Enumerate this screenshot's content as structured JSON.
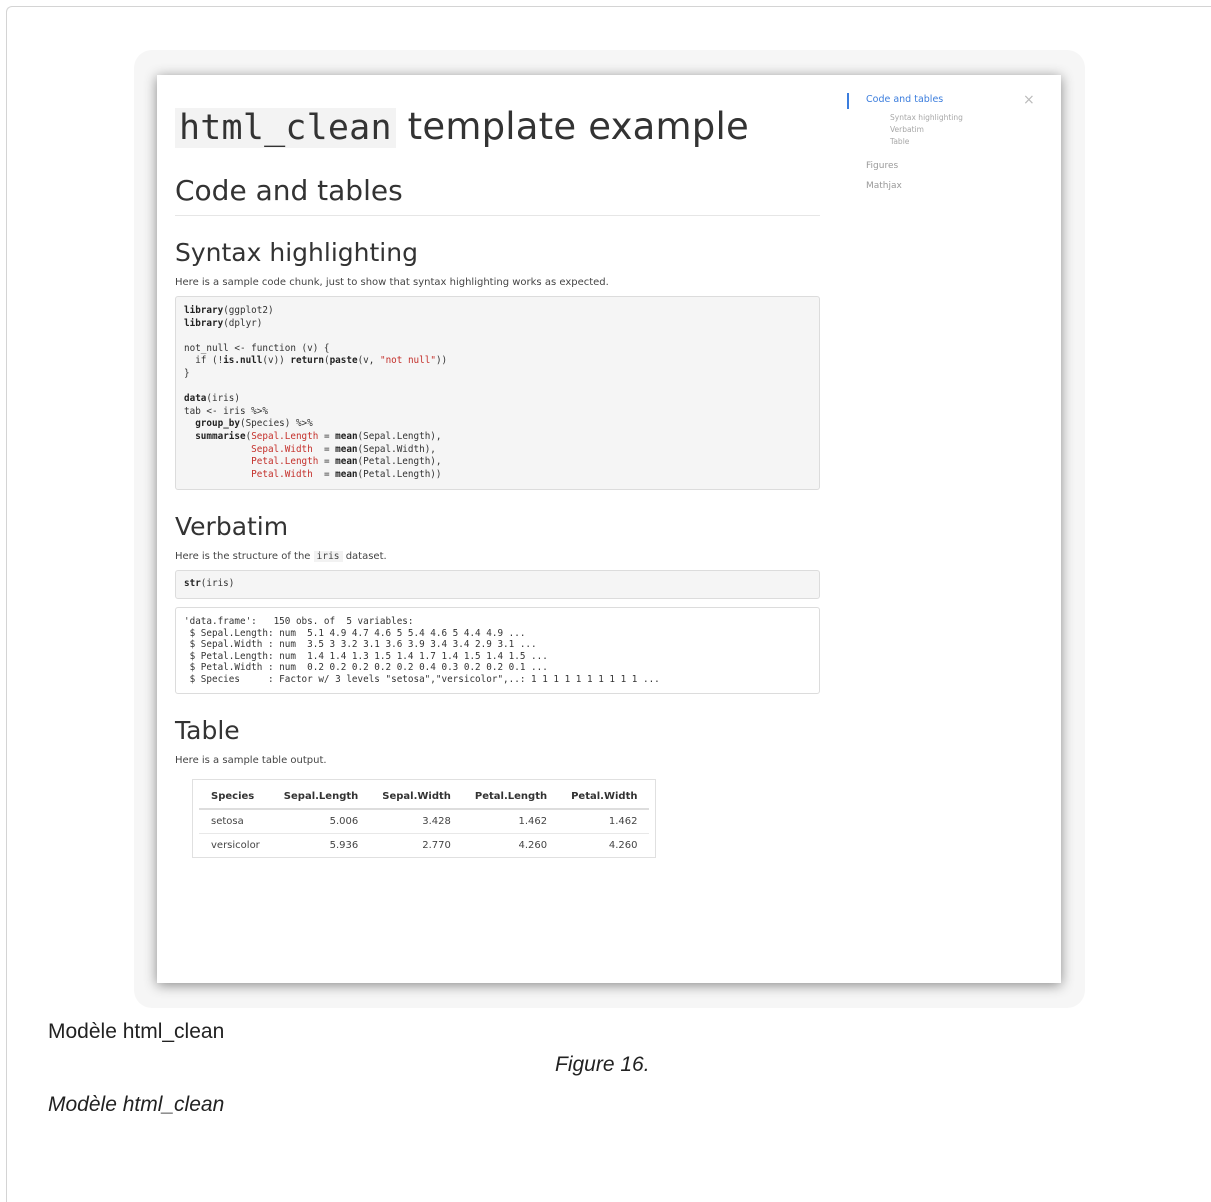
{
  "doc": {
    "title_code": "html_clean",
    "title_rest": " template example",
    "section_code_tables": "Code and tables",
    "sub_syntax": "Syntax highlighting",
    "syntax_para": "Here is a sample code chunk, just to show that syntax highlighting works as expected.",
    "sub_verbatim": "Verbatim",
    "verbatim_para_pre": "Here is the structure of the ",
    "verbatim_para_code": "iris",
    "verbatim_para_post": " dataset.",
    "str_call": "str(iris)",
    "str_output": "'data.frame':\t150 obs. of  5 variables:\n $ Sepal.Length: num  5.1 4.9 4.7 4.6 5 5.4 4.6 5 4.4 4.9 ...\n $ Sepal.Width : num  3.5 3 3.2 3.1 3.6 3.9 3.4 3.4 2.9 3.1 ...\n $ Petal.Length: num  1.4 1.4 1.3 1.5 1.4 1.7 1.4 1.5 1.4 1.5 ...\n $ Petal.Width : num  0.2 0.2 0.2 0.2 0.2 0.4 0.3 0.2 0.2 0.1 ...\n $ Species     : Factor w/ 3 levels \"setosa\",\"versicolor\",..: 1 1 1 1 1 1 1 1 1 1 ...",
    "sub_table": "Table",
    "table_para": "Here is a sample table output.",
    "table": {
      "headers": [
        "Species",
        "Sepal.Length",
        "Sepal.Width",
        "Petal.Length",
        "Petal.Width"
      ],
      "rows": [
        [
          "setosa",
          "5.006",
          "3.428",
          "1.462",
          "1.462"
        ],
        [
          "versicolor",
          "5.936",
          "2.770",
          "4.260",
          "4.260"
        ]
      ]
    }
  },
  "toc": {
    "active": "Code and tables",
    "subs": [
      "Syntax highlighting",
      "Verbatim",
      "Table"
    ],
    "others": [
      "Figures",
      "Mathjax"
    ],
    "close": "×"
  },
  "captions": {
    "top": "Modèle html_clean",
    "figure": "Figure 16.",
    "bottom": "Modèle html_clean"
  },
  "colors": {
    "toc_accent": "#3b7ddd",
    "string_red": "#c4302b"
  }
}
